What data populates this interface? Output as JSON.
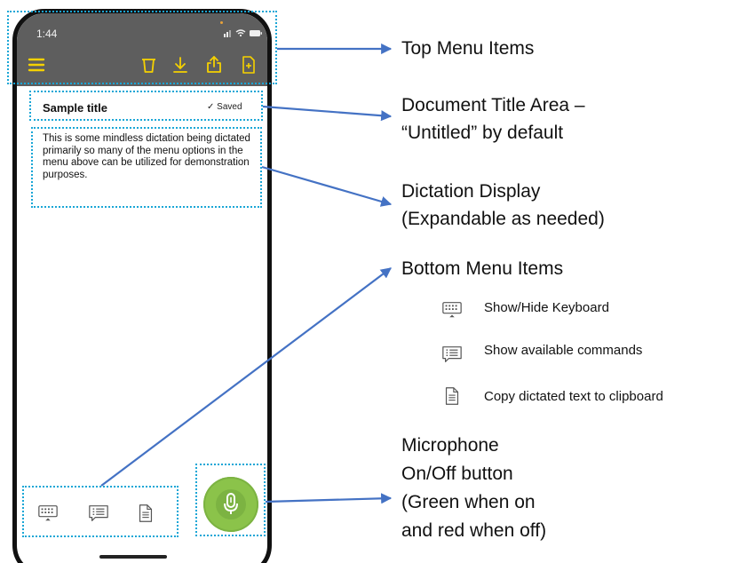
{
  "phone": {
    "status": {
      "time": "1:44"
    },
    "top_menu": {
      "icons": [
        "menu-icon",
        "trash-icon",
        "download-icon",
        "share-icon",
        "new-document-icon"
      ]
    },
    "document": {
      "title": "Sample title",
      "saved_label": "✓ Saved",
      "body": "This is some mindless dictation being dictated primarily so many of the menu options in the menu above can be utilized for demonstration purposes."
    },
    "bottom_menu": {
      "icons": [
        "keyboard-icon",
        "commands-icon",
        "copy-icon"
      ]
    },
    "mic": {
      "color": "#8bc34a"
    }
  },
  "callouts": {
    "top_menu": "Top Menu Items",
    "title_area_line1": "Document Title Area –",
    "title_area_line2": "“Untitled” by default",
    "dictation_line1": "Dictation Display",
    "dictation_line2": "(Expandable as needed)",
    "bottom_menu": "Bottom Menu Items",
    "legend": [
      {
        "icon": "keyboard-icon",
        "label": "Show/Hide Keyboard"
      },
      {
        "icon": "commands-icon",
        "label": "Show available commands"
      },
      {
        "icon": "copy-icon",
        "label": "Copy dictated text to clipboard"
      }
    ],
    "mic_line1": "Microphone",
    "mic_line2": "On/Off button",
    "mic_line3": "(Green when on",
    "mic_line4": "and red when off)"
  },
  "colors": {
    "accent_yellow": "#f5d100",
    "arrow_blue": "#4472c4",
    "highlight_cyan": "#1aa6d6",
    "toolbar_gray": "#5e5e5e"
  }
}
